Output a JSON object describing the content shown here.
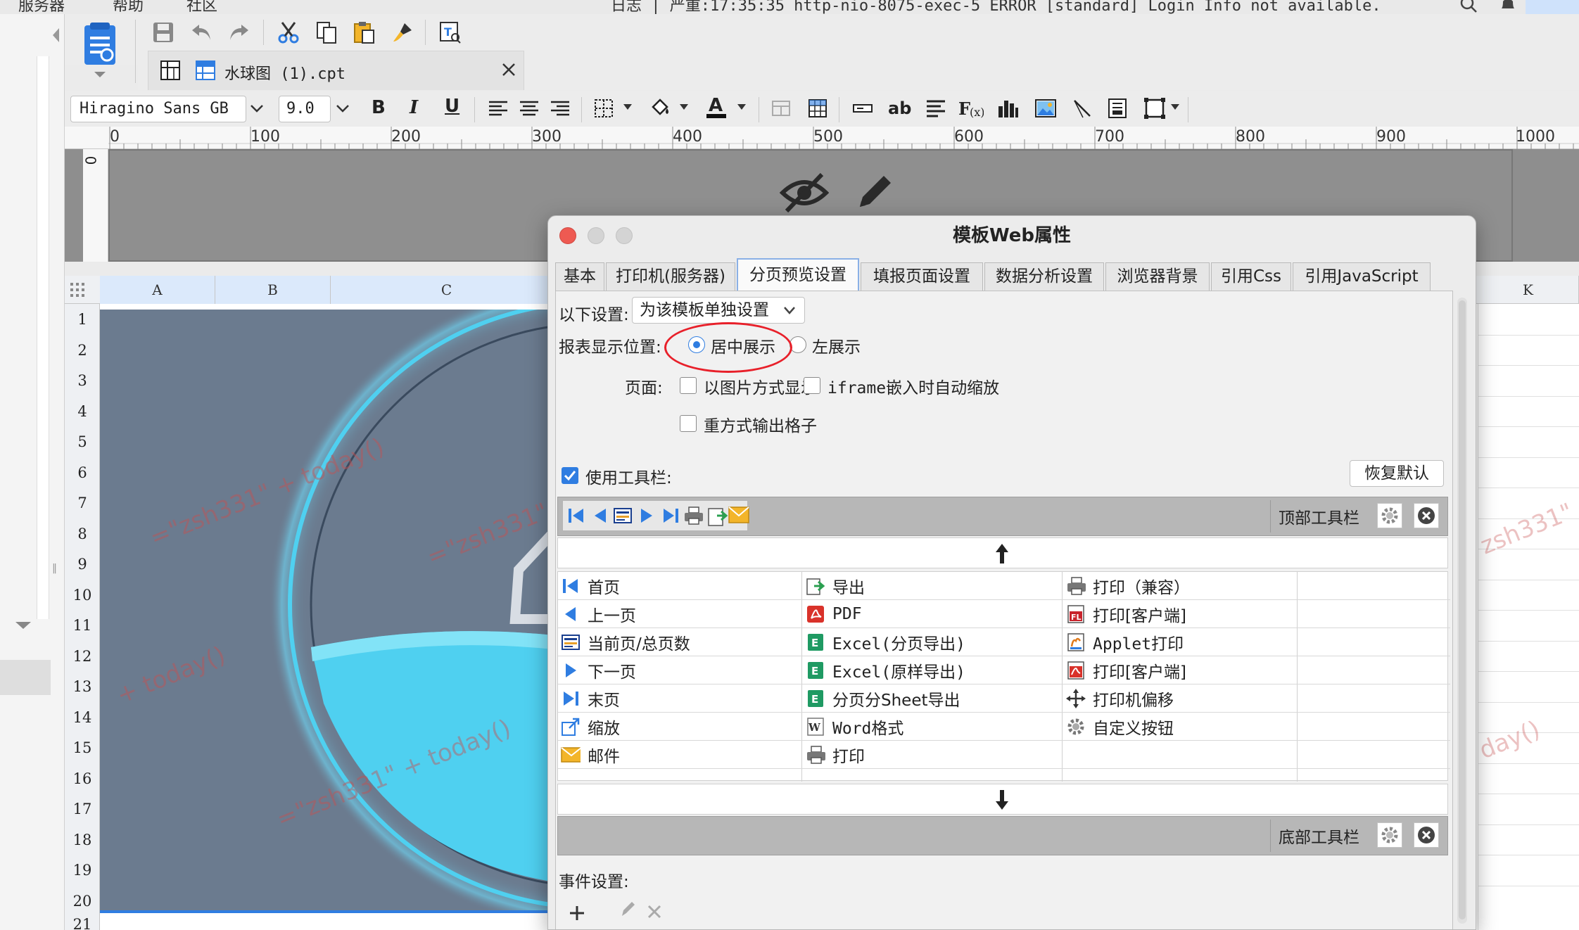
{
  "system_bar": {
    "left_menu_1": "服务器",
    "left_menu_2": "帮助",
    "left_menu_3": "社区",
    "status": "日志 | 严重:17:35:35 http-nio-8075-exec-5 ERROR [standard] Login Info not available."
  },
  "file_tab": {
    "filename": "水球图 (1).cpt"
  },
  "format_bar": {
    "font_name": "Hiragino Sans GB",
    "font_size": "9.0",
    "bold_label": "B",
    "italic_label": "I",
    "underline_label": "U",
    "text_sample": "ab"
  },
  "ruler": {
    "ticks": [
      "0",
      "100",
      "200",
      "300",
      "400",
      "500",
      "600",
      "700",
      "800",
      "900",
      "1000"
    ],
    "vertical_zero": "0"
  },
  "grid": {
    "columns": [
      "A",
      "B",
      "C",
      "K"
    ],
    "rows": [
      "1",
      "2",
      "3",
      "4",
      "5",
      "6",
      "7",
      "8",
      "9",
      "10",
      "11",
      "12",
      "13",
      "14",
      "15",
      "16",
      "17",
      "18",
      "19",
      "20",
      "21"
    ]
  },
  "watermarks": [
    "=\"zsh331\" + today()",
    "=\"zsh331\"",
    "+ today()",
    "=\"zsh331\" + today()",
    "zsh331\"",
    "day()"
  ],
  "dialog": {
    "title": "模板Web属性",
    "tabs": [
      "基本",
      "打印机(服务器)",
      "分页预览设置",
      "填报页面设置",
      "数据分析设置",
      "浏览器背景",
      "引用Css",
      "引用JavaScript"
    ],
    "active_tab": "分页预览设置",
    "settings_label": "以下设置:",
    "settings_value": "为该模板单独设置",
    "position_label": "报表显示位置:",
    "position_center": "居中展示",
    "position_left": "左展示",
    "page_label": "页面:",
    "opt_image": "以图片方式显示",
    "opt_iframe": "iframe嵌入时自动缩放",
    "opt_grid": "重方式输出格子",
    "use_toolbar": "使用工具栏:",
    "restore_default": "恢复默认",
    "top_toolbar": "顶部工具栏",
    "bottom_toolbar": "底部工具栏",
    "events_label": "事件设置:",
    "buttons": [
      [
        "首页",
        "导出",
        "打印（兼容）"
      ],
      [
        "上一页",
        "PDF",
        "打印[客户端]"
      ],
      [
        "当前页/总页数",
        "Excel(分页导出)",
        "Applet打印"
      ],
      [
        "下一页",
        "Excel(原样导出)",
        "打印[客户端]"
      ],
      [
        "末页",
        "分页分Sheet导出",
        "打印机偏移"
      ],
      [
        "缩放",
        "Word格式",
        "自定义按钮"
      ],
      [
        "邮件",
        "打印",
        ""
      ]
    ]
  },
  "colors": {
    "accent_blue": "#2f7de1",
    "annotation_red": "#e8202a",
    "liquid_cyan": "#4fd0f0",
    "picture_bg": "#6b7b8f"
  }
}
